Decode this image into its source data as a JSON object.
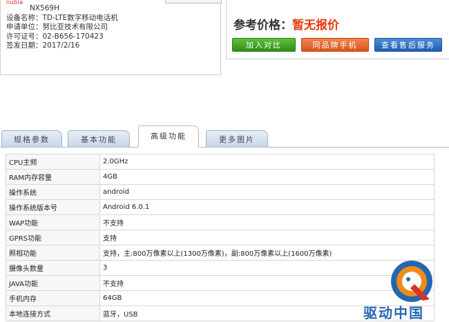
{
  "cert": {
    "logo": "nubia",
    "model": "NX569H",
    "device_label": "设备名称：",
    "device_value": "TD-LTE数字移动电话机",
    "applicant_label": "申请单位：",
    "applicant_value": "努比亚技术有限公司",
    "license_label": "许可证号：",
    "license_value": "02-B656-170423",
    "date_label": "签发日期：",
    "date_value": "2017/2/16"
  },
  "price": {
    "label": "参考价格：",
    "value": "暂无报价",
    "buttons": [
      "加入对比",
      "同品牌手机",
      "查看售后服务"
    ]
  },
  "tabs": [
    "规格参数",
    "基本功能",
    "高级功能",
    "更多图片"
  ],
  "active_tab": 2,
  "specs": [
    {
      "key": "CPU主频",
      "value": "2.0GHz"
    },
    {
      "key": "RAM内存容量",
      "value": "4GB"
    },
    {
      "key": "操作系统",
      "value": "android"
    },
    {
      "key": "操作系统版本号",
      "value": "Android 6.0.1"
    },
    {
      "key": "WAP功能",
      "value": "不支持"
    },
    {
      "key": "GPRS功能",
      "value": "支持"
    },
    {
      "key": "照相功能",
      "value": "支持，主:800万像素以上(1300万像素)，副:800万像素以上(1600万像素)"
    },
    {
      "key": "摄像头数量",
      "value": "3"
    },
    {
      "key": "JAVA功能",
      "value": "不支持"
    },
    {
      "key": "手机内存",
      "value": "64GB"
    },
    {
      "key": "本地连接方式",
      "value": "蓝牙，USB"
    }
  ],
  "watermark": {
    "text": "驱动中国",
    "colors": {
      "blue": "#2467b0",
      "orange": "#f08a1c",
      "red": "#d8342a"
    }
  },
  "colors": {
    "price_value": "#e8380d",
    "btn_green": "#2f8e17",
    "btn_orange": "#d9541e",
    "btn_blue": "#1f5fae"
  }
}
